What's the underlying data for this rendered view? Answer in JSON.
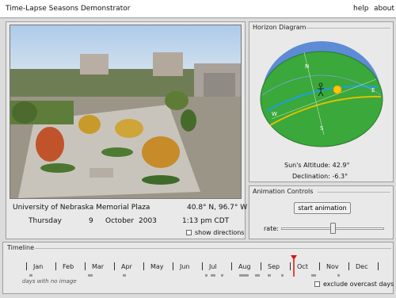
{
  "app": {
    "title": "Time-Lapse Seasons Demonstrator",
    "menu": {
      "help": "help",
      "about": "about"
    }
  },
  "photo_panel": {
    "location": "University of Nebraska Memorial Plaza",
    "coordinates": "40.8° N, 96.7° W",
    "day_of_week": "Thursday",
    "day": "9",
    "month": "October",
    "year": "2003",
    "time": "1:13 pm CDT",
    "show_directions_label": "show directions",
    "show_directions_checked": false
  },
  "horizon": {
    "legend": "Horizon Diagram",
    "directions": {
      "north": "N",
      "east": "E",
      "south": "S",
      "west": "W"
    },
    "altitude_text": "Sun's Altitude: 42.9°",
    "declination_text": "Declination: -6.3°",
    "sun_altitude_deg": 42.9,
    "declination_deg": -6.3,
    "sun_color": "#ffc800",
    "ground_color": "#3aa83a",
    "sky_color": "#5d8bd6"
  },
  "animation": {
    "legend": "Animation Controls",
    "start_label": "start animation",
    "rate_label": "rate:",
    "rate_fraction": 0.5
  },
  "timeline": {
    "legend": "Timeline",
    "months": [
      "Jan",
      "Feb",
      "Mar",
      "Apr",
      "May",
      "Jun",
      "Jul",
      "Aug",
      "Sep",
      "Oct",
      "Nov",
      "Dec"
    ],
    "marker_date": "October 9",
    "marker_color": "#dd1111",
    "no_image_label": "days with no image",
    "exclude_overcast_label": "exclude overcast days",
    "exclude_overcast_checked": false
  }
}
